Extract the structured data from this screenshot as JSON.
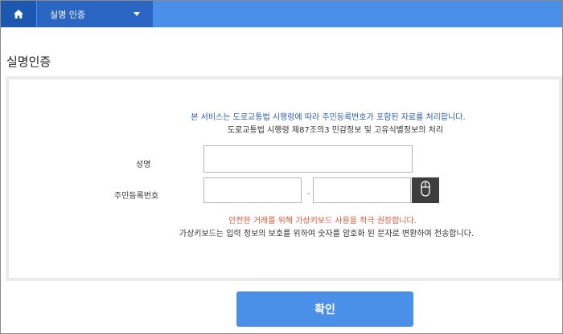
{
  "nav": {
    "home_icon": "home-icon",
    "menu_label": "실명 인증",
    "caret_icon": "caret-down-icon"
  },
  "page": {
    "title": "실명인증"
  },
  "form": {
    "info_line1": "본 서비스는 도로교통법 시행령에 따라 주민등록번호가 포함된 자료를 처리합니다.",
    "info_line2": "도로교통법 시행령 제87조의3 민감정보 및 고유식별정보의 처리",
    "name_label": "성명",
    "name_value": "",
    "rrn_label": "주민등록번호",
    "rrn_front_value": "",
    "rrn_separator": "-",
    "rrn_back_value": "",
    "mouse_icon": "mouse-icon",
    "warning": "안전한 거래를 위해 가상키보드 사용을 적극 권장합니다.",
    "note": "가상키보드는 입력 정보의 보호를 위하여 숫자를 암호화 된 문자로 변환하여 전송합니다."
  },
  "actions": {
    "confirm_label": "확인"
  },
  "colors": {
    "accent": "#4a90e8",
    "nav_dark": "#1c58b0",
    "info_blue": "#2a5db0",
    "warning_red": "#e0593a"
  }
}
